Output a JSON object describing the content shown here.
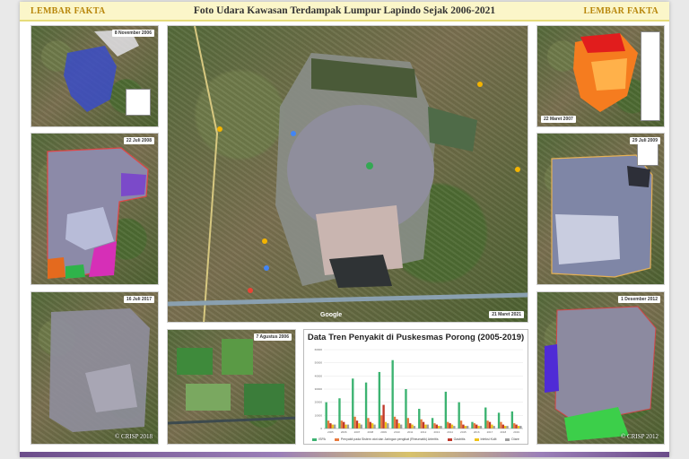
{
  "header": {
    "left_tag": "LEMBAR FAKTA",
    "right_tag": "LEMBAR FAKTA",
    "title": "Foto Udara Kawasan Terdampak Lumpur Lapindo Sejak 2006-2021"
  },
  "photos": {
    "top_left": {
      "date": "8 November 2006"
    },
    "mid_left": {
      "date": "22 Juli 2008"
    },
    "bottom_left": {
      "date": "16 Juli 2017",
      "credit": "© CRISP 2018"
    },
    "center": {
      "date": "21 Maret 2021",
      "map_brand": "Google"
    },
    "bottom_center": {
      "date": "7 Agustus 2006"
    },
    "top_right": {
      "date": "22 Maret 2007"
    },
    "mid_right": {
      "date": "29 Juli 2009"
    },
    "bottom_right": {
      "date": "1 Desember 2012",
      "credit": "© CRISP 2012"
    }
  },
  "colors": {
    "header_bg": "#fbf6c9",
    "tag_color": "#b8860b",
    "mud_gray": "#8f8e9c",
    "series_green": "#3cb371",
    "series_orange": "#e87a3e",
    "series_red": "#c0392b",
    "series_yellow": "#f0c419",
    "series_gray": "#9e9e9e"
  },
  "chart_data": {
    "type": "bar",
    "title": "Data Tren Penyakit di Puskesmas Porong (2005-2019)",
    "categories": [
      "2005",
      "2006",
      "2007",
      "2008",
      "2009",
      "2010",
      "2011",
      "2012",
      "2013",
      "2014",
      "2015",
      "2016",
      "2017",
      "2018",
      "2019"
    ],
    "ylim": [
      0,
      60000
    ],
    "series": [
      {
        "name": "ISPA",
        "values": [
          20000,
          23000,
          38000,
          35000,
          43000,
          52000,
          30000,
          15000,
          8000,
          28000,
          20000,
          5000,
          16000,
          12000,
          13000
        ]
      },
      {
        "name": "Penyakit pada Sistem otot dan Jaringan pengikat (Rheumatik) Arteritis",
        "values": [
          6000,
          6000,
          9000,
          8000,
          10000,
          9000,
          8000,
          7000,
          4000,
          5000,
          6000,
          4000,
          6000,
          5000,
          4000
        ]
      },
      {
        "name": "Gastritis",
        "values": [
          4000,
          5000,
          6000,
          5000,
          18000,
          7000,
          4000,
          5000,
          3000,
          4000,
          3000,
          3000,
          5000,
          3000,
          3000
        ]
      },
      {
        "name": "Infeksi Kulit",
        "values": [
          3000,
          3000,
          4000,
          4000,
          5000,
          4000,
          3000,
          3000,
          2000,
          3000,
          2000,
          2000,
          3000,
          2000,
          2000
        ]
      },
      {
        "name": "Diare",
        "values": [
          3000,
          3000,
          3000,
          3000,
          4000,
          3000,
          2000,
          3000,
          2000,
          2000,
          2000,
          2000,
          2000,
          2000,
          2000
        ]
      }
    ],
    "y_ticks": [
      "70000",
      "60000",
      "50000",
      "40000",
      "30000",
      "20000",
      "10000",
      "0"
    ],
    "grid": true,
    "legend": "bottom"
  }
}
